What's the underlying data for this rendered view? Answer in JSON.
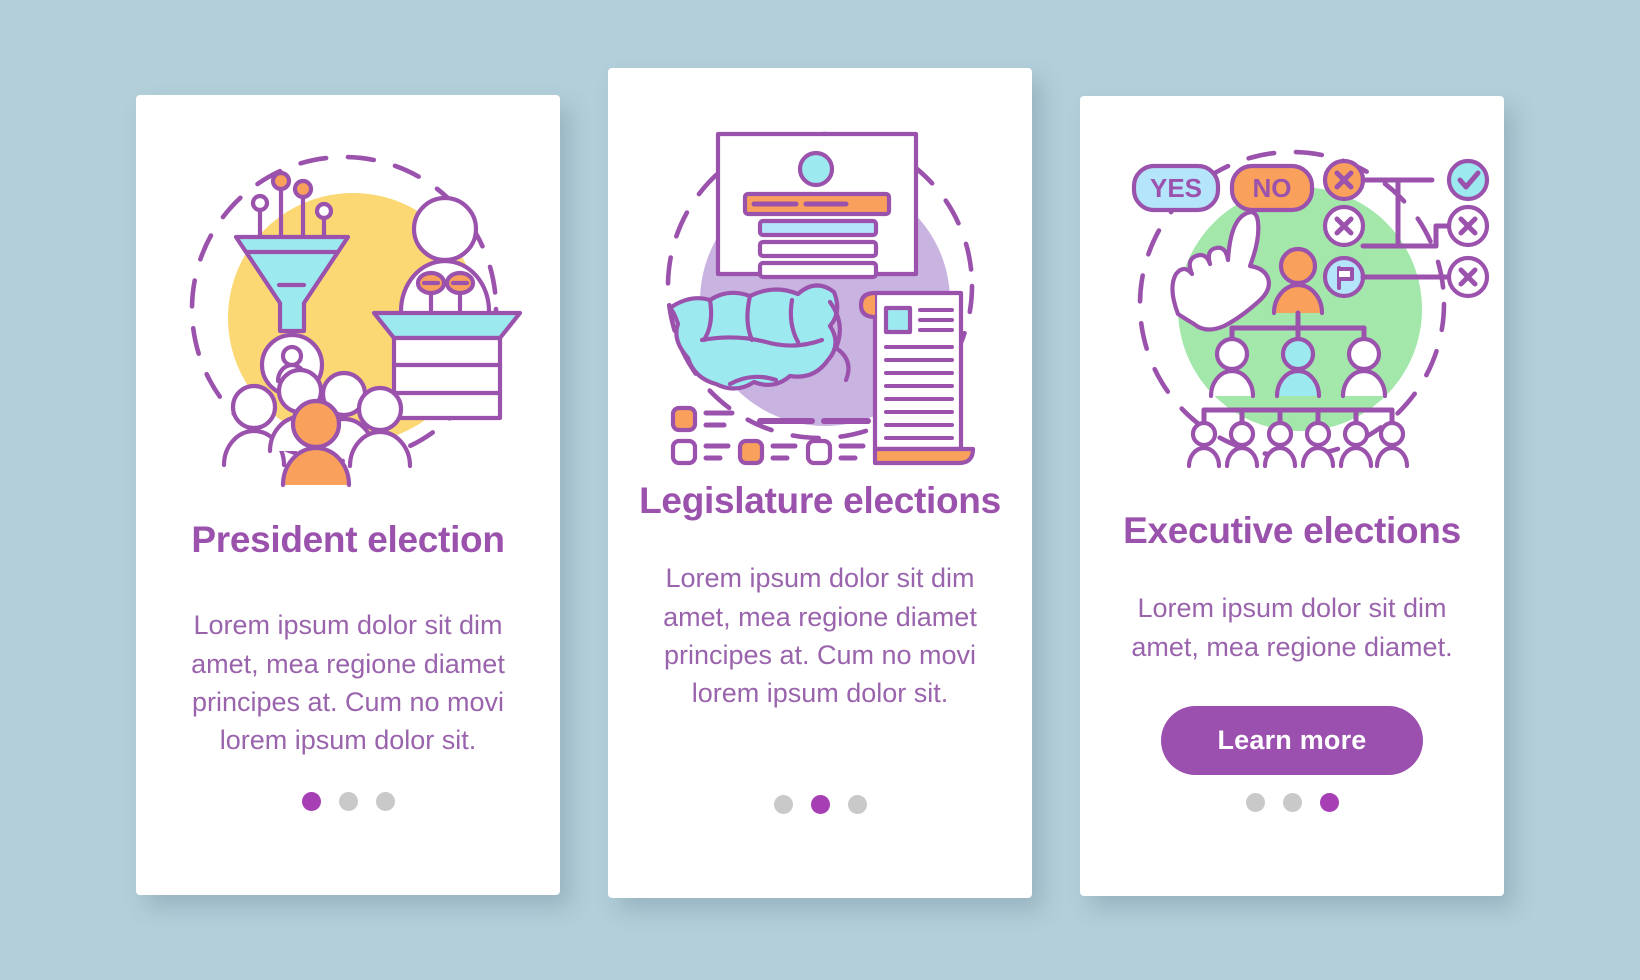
{
  "page": {
    "background_color": "#b2cfda",
    "card_background": "#ffffff",
    "accent_color": "#9b4fae",
    "title_color": "#9b52ad",
    "body_color": "#9a64ad",
    "dot_active_color": "#a63fb4",
    "dot_inactive_color": "#c9c9c9"
  },
  "cards": [
    {
      "id": "president-election",
      "illustration_name": "president-election-illustration",
      "illustration_parts": [
        "funnel-icon",
        "podium-speaker-icon",
        "crowd-of-people-icon",
        "avatar-badge-icon",
        "dashed-circle-frame"
      ],
      "blob_color": "#fbd873",
      "title": "President election",
      "body": "Lorem ipsum dolor sit dim amet, mea regione diamet principes at. Cum no movi lorem ipsum dolor sit.",
      "has_cta": false,
      "cta_label": "",
      "dots": {
        "count": 3,
        "active_index": 0
      }
    },
    {
      "id": "legislature-elections",
      "illustration_name": "legislature-elections-illustration",
      "illustration_parts": [
        "ballot-card-icon",
        "map-icon",
        "scroll-document-icon",
        "checkbox-list-icon",
        "dashed-circle-frame"
      ],
      "blob_color": "#c9b3e0",
      "title": "Legislature elections",
      "body": "Lorem ipsum dolor sit dim amet, mea regione diamet principes at. Cum no movi lorem ipsum dolor sit.",
      "has_cta": false,
      "cta_label": "",
      "dots": {
        "count": 3,
        "active_index": 1
      }
    },
    {
      "id": "executive-elections",
      "illustration_name": "executive-elections-illustration",
      "illustration_parts": [
        "yes-pill-badge",
        "no-pill-badge",
        "pointing-hand-icon",
        "org-chart-icon",
        "cross-circle-icon",
        "flag-circle-icon",
        "check-circle-icon",
        "dashed-circle-frame"
      ],
      "blob_color": "#a3e7ab",
      "yes_label": "YES",
      "no_label": "NO",
      "title": "Executive elections",
      "body": "Lorem ipsum dolor sit dim amet, mea regione diamet.",
      "has_cta": true,
      "cta_label": "Learn more",
      "dots": {
        "count": 3,
        "active_index": 2
      }
    }
  ]
}
